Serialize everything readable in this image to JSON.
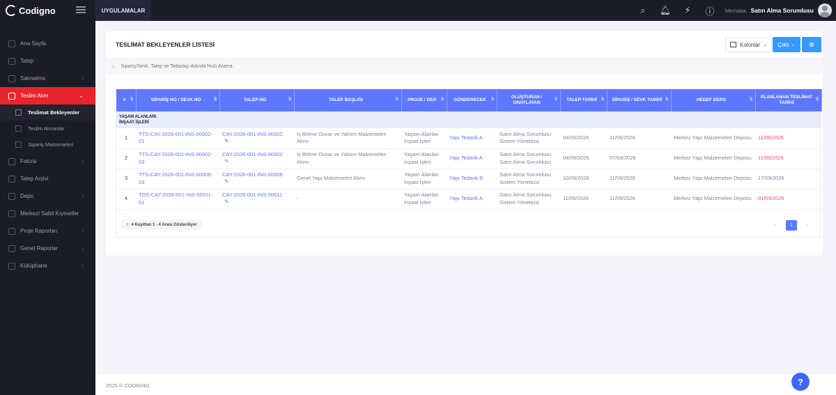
{
  "topbar": {
    "brand": "Codigno",
    "apps_label": "UYGULAMALAR",
    "greeting": "Merhaba,",
    "user_name": "Satın Alma Sorumlusu",
    "icons": [
      "search-icon",
      "bell-icon",
      "lightning-icon",
      "help-circle-icon"
    ]
  },
  "sidebar": {
    "items": [
      {
        "label": "Ana Sayfa",
        "chevron": false
      },
      {
        "label": "Talep",
        "chevron": false
      },
      {
        "label": "Satınalma",
        "chevron": true
      },
      {
        "label": "Teslim Alım",
        "chevron": true,
        "active": true
      },
      {
        "label": "Fatura",
        "chevron": true
      },
      {
        "label": "Talep Arşivi",
        "chevron": false
      },
      {
        "label": "Depo",
        "chevron": true
      },
      {
        "label": "Merkezi Sabit Kıymetler",
        "chevron": false
      },
      {
        "label": "Proje Raporları",
        "chevron": true
      },
      {
        "label": "Genel Raporlar",
        "chevron": true
      },
      {
        "label": "Kütüphane",
        "chevron": true
      }
    ],
    "subitems": [
      {
        "label": "Teslimat Bekleyenler",
        "active": true
      },
      {
        "label": "Teslim Alınanlar"
      },
      {
        "label": "Sipariş Malzemeleri"
      }
    ]
  },
  "main": {
    "title": "TESLİMAT BEKLEYENLER LİSTESİ",
    "columns_button": "Kolonlar",
    "output_button": "Çıktı",
    "search_placeholder": "Sipariş/Sevk, Talep ve Tedarikçi Adında Hızlı Arama",
    "table": {
      "headers": [
        "#",
        "SİPARİŞ NO / SEVK NO",
        "TALEP NO",
        "TALEP BAŞLIĞI",
        "PROJE / DEP.",
        "GÖNDERECEK",
        "OLUŞTURAN / ONAYLAYAN",
        "TALEP TARİHİ",
        "SİPARİŞ / SEVK TARİHİ",
        "HEDEF DEPO",
        "PLANLANAN TESLİMAT TARİHİ"
      ],
      "group_label_1": "YAŞAM ALANLARI",
      "group_label_2": "İNŞAAT İŞLERİ",
      "rows": [
        {
          "no": "1",
          "order": "TTS-CAY-2026-001-INS-00002-01",
          "request": "CAY-2026-001-INS-00002",
          "title": "İç Bölme Duvar ve Yalıtım Malzemeleri Alımı",
          "project": "Yaşam Alanları İnşaat İşleri",
          "sender": "Yapı Tedarik A",
          "creator": "Satın Alma Sorumlusu Sistem Yöneticisi",
          "req_date": "04/09/2026",
          "order_date": "11/09/2026",
          "depot": "Merkez Yapı Malzemeleri Deposu",
          "planned": "11/09/2026",
          "planned_red": true
        },
        {
          "no": "2",
          "order": "TTS-CAY-2026-001-INS-00002-03",
          "request": "CAY-2026-001-INS-00002",
          "title": "İç Bölme Duvar ve Yalıtım Malzemeleri Alımı",
          "project": "Yaşam Alanları İnşaat İşleri",
          "sender": "Yapı Tedarik A",
          "creator": "Satın Alma Sorumlusu Satın Alma Sorumlusu",
          "req_date": "04/09/2026",
          "order_date": "07/09/2026",
          "depot": "Merkez Yapı Malzemeleri Deposu",
          "planned": "11/09/2026",
          "planned_red": true
        },
        {
          "no": "3",
          "order": "TTS-CAY-2026-001-INS-00008-03",
          "request": "CAY-2026-001-INS-00008",
          "title": "Genel Yapı Malzemeleri Alımı",
          "project": "Yaşam Alanları İnşaat İşleri",
          "sender": "Yapı Tedarik B",
          "creator": "Satın Alma Sorumlusu Sistem Yöneticisi",
          "req_date": "10/09/2026",
          "order_date": "11/09/2026",
          "depot": "Merkez Yapı Malzemeleri Deposu",
          "planned": "17/09/2026",
          "planned_red": false
        },
        {
          "no": "4",
          "order": "TDS-CAY-2026-001-INS-00011-01",
          "request": "CAY-2026-001-INS-00011",
          "title": "-",
          "project": "Yaşam Alanları İnşaat İşleri",
          "sender": "Yapı Tedarik A",
          "creator": "Satın Alma Sorumlusu Sistem Yöneticisi",
          "req_date": "11/09/2026",
          "order_date": "11/09/2026",
          "depot": "Merkez Yapı Malzemeleri Deposu",
          "planned": "01/09/2026",
          "planned_red": true
        }
      ]
    },
    "pagination_info": "4 Kayıttan 1 - 4 Arası Gösteriliyor",
    "current_page": "1"
  },
  "footer": {
    "copyright": "2025 © CODIGNO"
  },
  "colors": {
    "accent": "#5d78ff",
    "active_menu": "#e8242c",
    "primary_button": "#3699ff",
    "overdue": "#f64e60"
  }
}
